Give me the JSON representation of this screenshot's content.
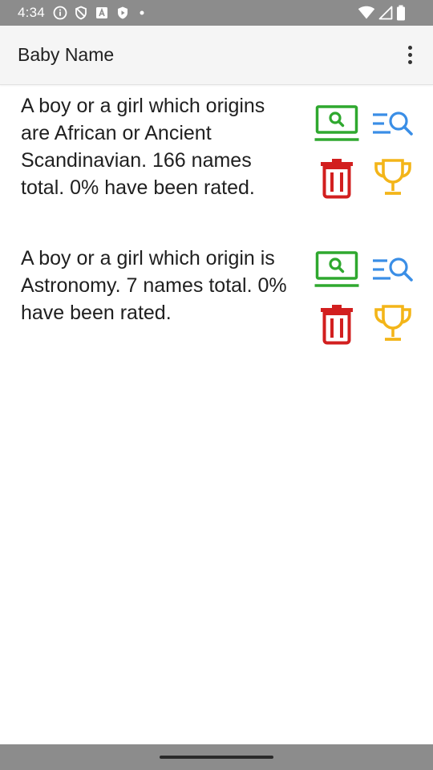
{
  "status_bar": {
    "time": "4:34",
    "icons": [
      "info-icon",
      "shield-icon",
      "a-box-icon",
      "play-shield-icon",
      "dot-icon",
      "wifi-icon",
      "signal-icon",
      "battery-icon"
    ]
  },
  "app_bar": {
    "title": "Baby Name",
    "menu_icon": "more-vert-icon"
  },
  "lists": [
    {
      "description": "A boy or a girl which origins are African or Ancient Scandinavian. 166 names total. 0% have been rated.",
      "actions": [
        "browse-icon",
        "search-list-icon",
        "delete-icon",
        "trophy-icon"
      ]
    },
    {
      "description": "A boy or a girl which origin is Astronomy. 7 names total. 0% have been rated.",
      "actions": [
        "browse-icon",
        "search-list-icon",
        "delete-icon",
        "trophy-icon"
      ]
    }
  ],
  "colors": {
    "status_bar": "#8c8c8c",
    "app_bar": "#f5f5f5",
    "browse": "#2fa82f",
    "search": "#3a8ee6",
    "delete": "#d21f1f",
    "trophy": "#f3b519"
  }
}
